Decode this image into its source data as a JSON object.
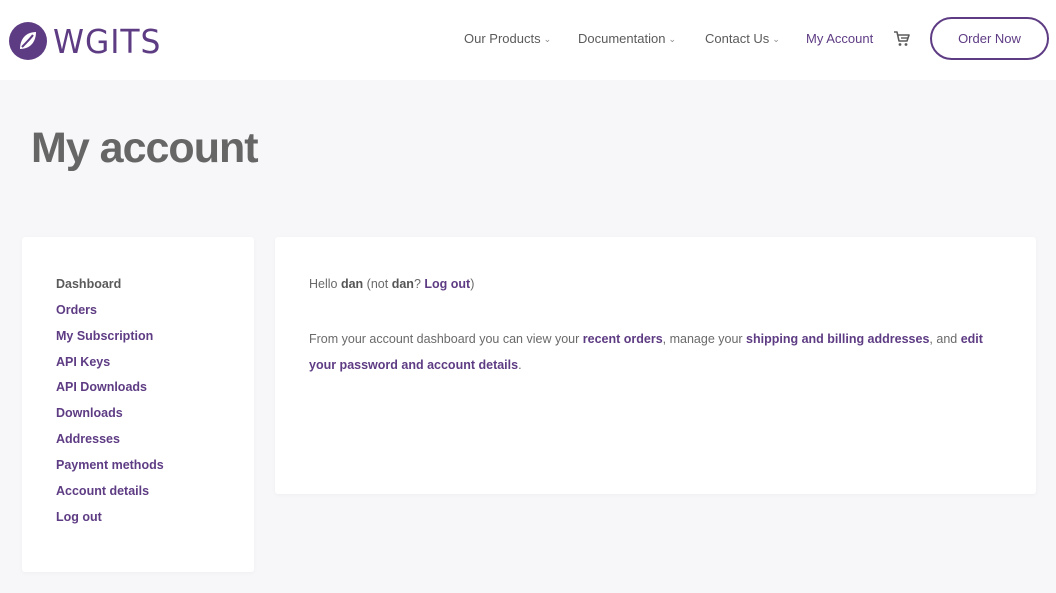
{
  "brand": {
    "logo_text": "WGITS",
    "color": "#5e3c84"
  },
  "nav": {
    "items": [
      {
        "label": "Our Products",
        "has_dropdown": true
      },
      {
        "label": "Documentation",
        "has_dropdown": true
      },
      {
        "label": "Contact Us",
        "has_dropdown": true
      },
      {
        "label": "My Account",
        "has_dropdown": false,
        "active": true
      }
    ],
    "dropdown_glyph": "⌄",
    "cart_icon": "cart-icon",
    "order_button": "Order Now"
  },
  "page": {
    "title": "My account"
  },
  "sidebar": {
    "items": [
      {
        "label": "Dashboard"
      },
      {
        "label": "Orders"
      },
      {
        "label": "My Subscription"
      },
      {
        "label": "API Keys"
      },
      {
        "label": "API Downloads"
      },
      {
        "label": "Downloads"
      },
      {
        "label": "Addresses"
      },
      {
        "label": "Payment methods"
      },
      {
        "label": "Account details"
      },
      {
        "label": "Log out"
      }
    ]
  },
  "dashboard": {
    "hello_prefix": "Hello ",
    "username": "dan",
    "not_prefix": " (not ",
    "not_user": "dan",
    "not_q": "? ",
    "logout_link": "Log out",
    "close_paren": ")",
    "para_1": "From your account dashboard you can view your ",
    "recent_orders": "recent orders",
    "para_2": ", manage your ",
    "addresses_link": "shipping and billing addresses",
    "para_3": ", and ",
    "account_link": "edit your password and account details",
    "para_4": "."
  }
}
